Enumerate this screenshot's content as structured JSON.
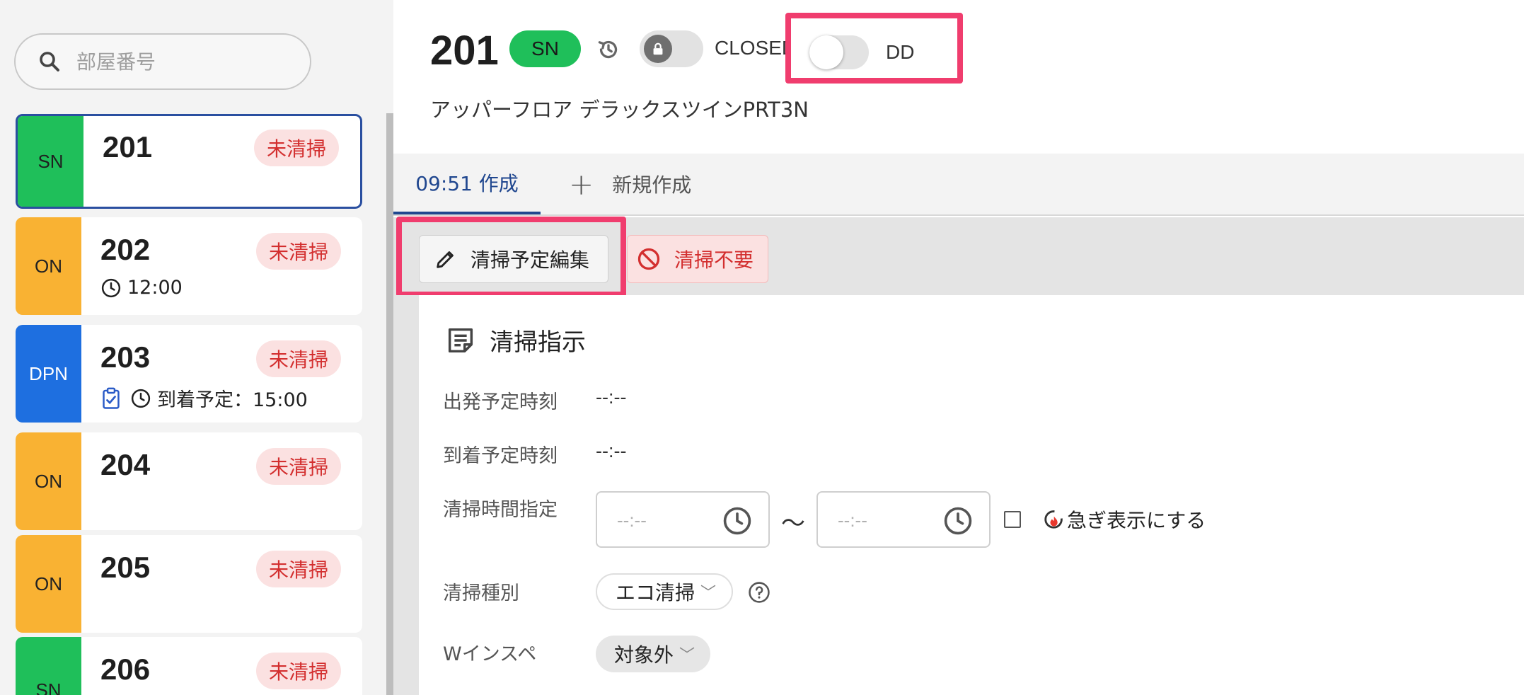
{
  "search": {
    "placeholder": "部屋番号"
  },
  "rooms": [
    {
      "tag": "SN",
      "number": "201",
      "status": "未清掃",
      "sub_text": ""
    },
    {
      "tag": "ON",
      "number": "202",
      "status": "未清掃",
      "sub_text": "12:00"
    },
    {
      "tag": "DPN",
      "number": "203",
      "status": "未清掃",
      "sub_text": "到着予定：15:00"
    },
    {
      "tag": "ON",
      "number": "204",
      "status": "未清掃",
      "sub_text": ""
    },
    {
      "tag": "ON",
      "number": "205",
      "status": "未清掃",
      "sub_text": ""
    },
    {
      "tag": "SN",
      "number": "206",
      "status": "未清掃",
      "sub_text": ""
    }
  ],
  "colors": {
    "sn": "#1fbf5a",
    "on": "#f9b233",
    "dpn": "#1e6fe0",
    "highlight": "#f03d6e",
    "accent": "#20478f",
    "danger": "#d32f2f"
  },
  "header": {
    "room_number": "201",
    "type_badge": "SN",
    "closed_label": "CLOSED",
    "dd_label": "DD",
    "dd_enabled": false,
    "room_type_name": "アッパーフロア デラックスツインPRT3N"
  },
  "tabs": {
    "created": "09:51 作成",
    "new": "新規作成"
  },
  "actions": {
    "edit": "清掃予定編集",
    "no_clean": "清掃不要"
  },
  "instructions": {
    "title": "清掃指示",
    "departure_label": "出発予定時刻",
    "departure_value": "--:--",
    "arrival_label": "到着予定時刻",
    "arrival_value": "--:--",
    "time_spec_label": "清掃時間指定",
    "time_from_placeholder": "--:--",
    "time_to_placeholder": "--:--",
    "tilde": "〜",
    "urgent_label": "急ぎ表示にする",
    "urgent_checked": false,
    "clean_type_label": "清掃種別",
    "clean_type_value": "エコ清掃",
    "w_inspect_label": "Wインスペ",
    "w_inspect_value": "対象外"
  }
}
